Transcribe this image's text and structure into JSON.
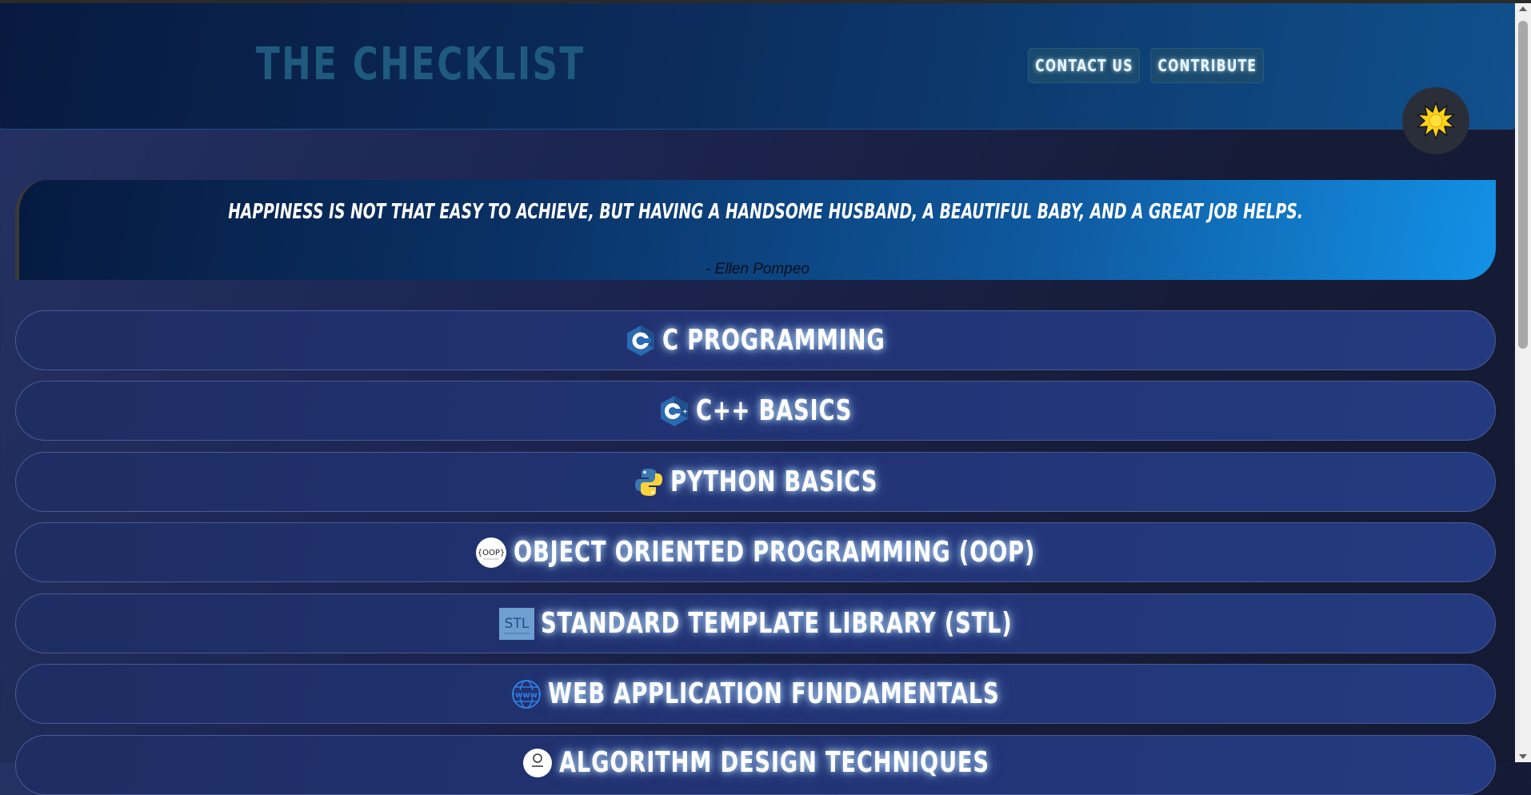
{
  "header": {
    "brand": "THE CHECKLIST",
    "nav": [
      {
        "label": "CONTACT US"
      },
      {
        "label": "CONTRIBUTE"
      }
    ],
    "theme_toggle_icon": "sun-icon"
  },
  "quote": {
    "text": "HAPPINESS IS NOT THAT EASY TO ACHIEVE, BUT HAVING A HANDSOME HUSBAND, A BEAUTIFUL BABY, AND A GREAT JOB HELPS.",
    "author": "- Ellen Pompeo"
  },
  "topics": [
    {
      "label": "C PROGRAMMING",
      "icon": "c-logo-icon"
    },
    {
      "label": "C++ BASICS",
      "icon": "cpp-logo-icon"
    },
    {
      "label": "PYTHON BASICS",
      "icon": "python-logo-icon"
    },
    {
      "label": "OBJECT ORIENTED PROGRAMMING (OOP)",
      "icon": "oop-logo-icon",
      "icon_text": "{OOP}"
    },
    {
      "label": "STANDARD TEMPLATE LIBRARY (STL)",
      "icon": "stl-logo-icon",
      "icon_text": "STL"
    },
    {
      "label": "WEB APPLICATION FUNDAMENTALS",
      "icon": "globe-www-icon",
      "icon_text": "www"
    },
    {
      "label": "ALGORITHM DESIGN TECHNIQUES",
      "icon": "algorithm-icon"
    }
  ],
  "colors": {
    "accent_blue": "#1391e6",
    "header_dark": "#081a40",
    "brand_text": "#1f5a7e",
    "topic_bg": "#223374"
  }
}
